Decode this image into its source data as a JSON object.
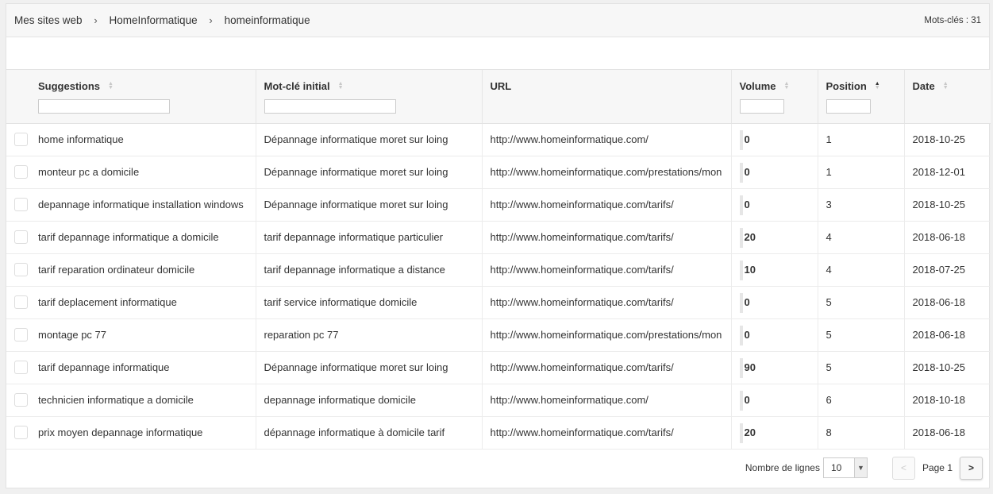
{
  "breadcrumb": {
    "items": [
      "Mes sites web",
      "HomeInformatique",
      "homeinformatique"
    ],
    "separator": "›"
  },
  "keyword_count": "Mots-clés : 31",
  "columns": {
    "suggestions": "Suggestions",
    "initial": "Mot-clé initial",
    "url": "URL",
    "volume": "Volume",
    "position": "Position",
    "date": "Date"
  },
  "sort": {
    "column": "position",
    "direction": "asc"
  },
  "rows": [
    {
      "suggestion": "home informatique",
      "initial": "Dépannage informatique moret sur loing",
      "url": "http://www.homeinformatique.com/",
      "volume": "0",
      "position": "1",
      "date": "2018-10-25"
    },
    {
      "suggestion": "monteur pc a domicile",
      "initial": "Dépannage informatique moret sur loing",
      "url": "http://www.homeinformatique.com/prestations/mon",
      "volume": "0",
      "position": "1",
      "date": "2018-12-01"
    },
    {
      "suggestion": "depannage informatique installation windows",
      "initial": "Dépannage informatique moret sur loing",
      "url": "http://www.homeinformatique.com/tarifs/",
      "volume": "0",
      "position": "3",
      "date": "2018-10-25"
    },
    {
      "suggestion": "tarif depannage informatique a domicile",
      "initial": "tarif depannage informatique particulier",
      "url": "http://www.homeinformatique.com/tarifs/",
      "volume": "20",
      "position": "4",
      "date": "2018-06-18"
    },
    {
      "suggestion": "tarif reparation ordinateur domicile",
      "initial": "tarif depannage informatique a distance",
      "url": "http://www.homeinformatique.com/tarifs/",
      "volume": "10",
      "position": "4",
      "date": "2018-07-25"
    },
    {
      "suggestion": "tarif deplacement informatique",
      "initial": "tarif service informatique domicile",
      "url": "http://www.homeinformatique.com/tarifs/",
      "volume": "0",
      "position": "5",
      "date": "2018-06-18"
    },
    {
      "suggestion": "montage pc 77",
      "initial": "reparation pc 77",
      "url": "http://www.homeinformatique.com/prestations/mon",
      "volume": "0",
      "position": "5",
      "date": "2018-06-18"
    },
    {
      "suggestion": "tarif depannage informatique",
      "initial": "Dépannage informatique moret sur loing",
      "url": "http://www.homeinformatique.com/tarifs/",
      "volume": "90",
      "position": "5",
      "date": "2018-10-25"
    },
    {
      "suggestion": "technicien informatique a domicile",
      "initial": "depannage informatique domicile",
      "url": "http://www.homeinformatique.com/",
      "volume": "0",
      "position": "6",
      "date": "2018-10-18"
    },
    {
      "suggestion": "prix moyen depannage informatique",
      "initial": "dépannage informatique à domicile tarif",
      "url": "http://www.homeinformatique.com/tarifs/",
      "volume": "20",
      "position": "8",
      "date": "2018-06-18"
    }
  ],
  "footer": {
    "rows_label": "Nombre de lignes",
    "rows_value": "10",
    "prev": "<",
    "page_label": "Page 1",
    "next": ">"
  },
  "icons": {
    "sort": "sort-arrows-icon",
    "dropdown": "chevron-down-icon"
  }
}
